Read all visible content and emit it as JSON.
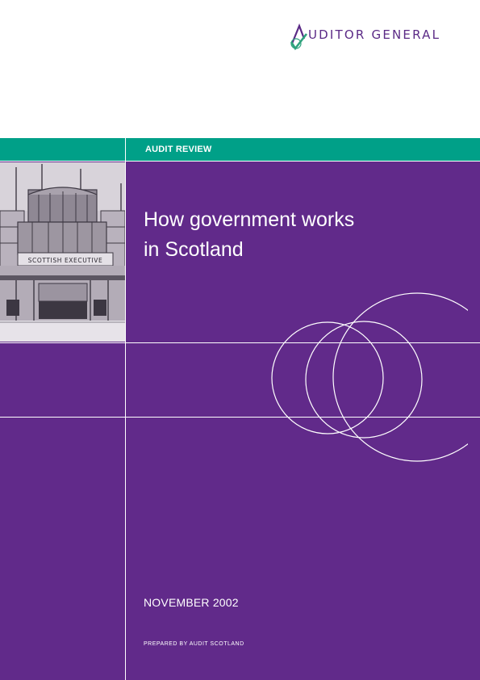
{
  "header": {
    "logo_text": "UDITOR GENERAL",
    "logo_initial": "A",
    "logo_icon": "checkmark-a-logo-icon"
  },
  "band": {
    "label": "AUDIT REVIEW"
  },
  "main": {
    "title_line1": "How government works",
    "title_line2": "in Scotland",
    "photo_sign_text": "SCOTTISH EXECUTIVE",
    "date": "NOVEMBER 2002",
    "prepared_by": "PREPARED BY AUDIT SCOTLAND"
  },
  "colors": {
    "purple": "#612a8a",
    "teal": "#00a088",
    "logo_purple": "#5b2a86",
    "logo_green": "#2fa27d"
  }
}
